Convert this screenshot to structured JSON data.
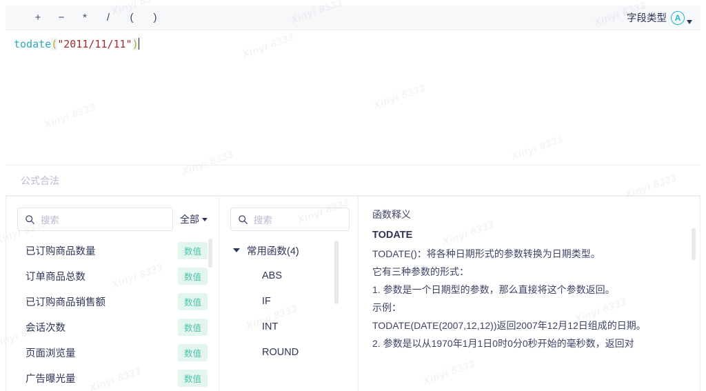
{
  "toolbar": {
    "operators": [
      "+",
      "−",
      "*",
      "/",
      "(",
      ")"
    ],
    "field_type_label": "字段类型",
    "at_icon_glyph": "A"
  },
  "editor": {
    "function_token": "todate",
    "open_paren": "(",
    "string_literal": "\"2011/11/11\"",
    "close_paren": ")"
  },
  "status": {
    "text": "公式合法"
  },
  "fields_pane": {
    "search_placeholder": "搜索",
    "search_value": "",
    "filter_label": "全部",
    "items": [
      {
        "name": "已订购商品数量",
        "badge": "数值"
      },
      {
        "name": "订单商品总数",
        "badge": "数值"
      },
      {
        "name": "已订购商品销售额",
        "badge": "数值"
      },
      {
        "name": "会话次数",
        "badge": "数值"
      },
      {
        "name": "页面浏览量",
        "badge": "数值"
      },
      {
        "name": "广告曝光量",
        "badge": "数值"
      }
    ]
  },
  "functions_pane": {
    "search_placeholder": "搜索",
    "search_value": "",
    "group_label": "常用函数(4)",
    "items": [
      "ABS",
      "IF",
      "INT",
      "ROUND"
    ]
  },
  "doc_pane": {
    "title": "函数释义",
    "function_name": "TODATE",
    "lines": [
      "TODATE()：将各种日期形式的参数转换为日期类型。",
      "它有三种参数的形式：",
      "1. 参数是一个日期型的参数，那么直接将这个参数返回。",
      "示例：",
      "TODATE(DATE(2007,12,12))返回2007年12月12日组成的日期。",
      "2. 参数是以从1970年1月1日0时0分0秒开始的毫秒数，返回对"
    ]
  },
  "watermark": {
    "text": "Xinyi 8333"
  },
  "colors": {
    "accent_teal": "#18b9c4",
    "badge_bg": "#e3f5ef",
    "badge_text": "#4fc3ac",
    "text_primary": "#2d3557",
    "text_muted": "#b9bcd0",
    "border": "#eceef3",
    "toolbar_bg": "#f7f8fa",
    "code_fn": "#2aa9b8",
    "code_string": "#a02828",
    "code_paren": "#c9a227"
  }
}
